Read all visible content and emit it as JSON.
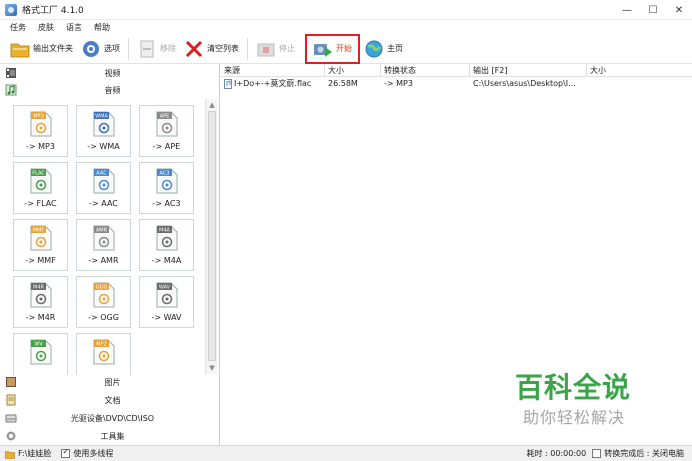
{
  "window": {
    "title": "格式工厂 4.1.0",
    "min": "—",
    "max": "☐",
    "close": "✕"
  },
  "menu": [
    "任务",
    "皮肤",
    "语言",
    "帮助"
  ],
  "toolbar": {
    "output_folder": "输出文件夹",
    "options": "选项",
    "remove": "移除",
    "clear_list": "清空列表",
    "stop": "停止",
    "start": "开始",
    "home": "主页"
  },
  "left": {
    "video": "视频",
    "audio": "音频",
    "picture": "图片",
    "document": "文档",
    "optical": "光驱设备\\DVD\\CD\\ISO",
    "toolbox": "工具集",
    "tiles": [
      {
        "label": "-> MP3",
        "tag": "MP3",
        "color": "#e8a23a"
      },
      {
        "label": "-> WMA",
        "tag": "WMA",
        "color": "#3a6fb8"
      },
      {
        "label": "-> APE",
        "tag": "APE",
        "color": "#8a8a8a"
      },
      {
        "label": "-> FLAC",
        "tag": "FLAC",
        "color": "#4aa04a"
      },
      {
        "label": "-> AAC",
        "tag": "AAC",
        "color": "#4a8ad4"
      },
      {
        "label": "-> AC3",
        "tag": "AC3",
        "color": "#4a8ad4"
      },
      {
        "label": "-> MMF",
        "tag": "MMF",
        "color": "#e8a23a"
      },
      {
        "label": "-> AMR",
        "tag": "AMR",
        "color": "#8a8a8a"
      },
      {
        "label": "-> M4A",
        "tag": "M4A",
        "color": "#6a6a6a"
      },
      {
        "label": "-> M4R",
        "tag": "M4R",
        "color": "#6a6a6a"
      },
      {
        "label": "-> OGG",
        "tag": "OGG",
        "color": "#e8a23a"
      },
      {
        "label": "-> WAV",
        "tag": "WAV",
        "color": "#6a6a6a"
      },
      {
        "label": "",
        "tag": "WV",
        "color": "#4aa04a"
      },
      {
        "label": "",
        "tag": "MP2",
        "color": "#e8a23a"
      }
    ]
  },
  "table": {
    "headers": [
      "来源",
      "大小",
      "转换状态",
      "输出 [F2]",
      "大小"
    ],
    "rows": [
      {
        "source": "I+Do+-+莫文蔚.flac",
        "size": "26.58M",
        "status": "-> MP3",
        "output": "C:\\Users\\asus\\Desktop\\I...",
        "out_size": ""
      }
    ]
  },
  "watermark": {
    "line1": "百科全说",
    "line2": "助你轻松解决"
  },
  "status": {
    "path": "F:\\娃娃脸",
    "multithread": "使用多线程",
    "elapsed": "耗时 : 00:00:00",
    "after": "转换完成后 : 关闭电脑"
  }
}
